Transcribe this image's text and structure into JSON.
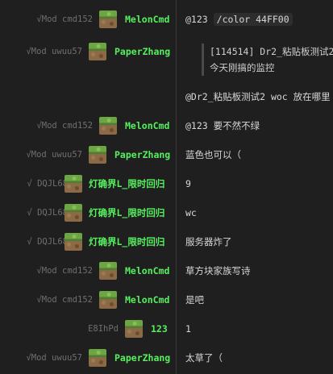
{
  "messages": [
    {
      "prefix": "√Mod cmd152",
      "name": "MelonCmd",
      "text": "@123 ",
      "code": "/color 44FF00"
    },
    {
      "prefix": "√Mod uwuu57",
      "name": "PaperZhang",
      "quote_line1": "[114514] Dr2_粘贴板测试2：",
      "quote_line2": "今天刚搞的监控",
      "text": "@Dr2_粘贴板测试2 woc 放在哪里"
    },
    {
      "prefix": "√Mod cmd152",
      "name": "MelonCmd",
      "text": "@123 要不然不绿"
    },
    {
      "prefix": "√Mod uwuu57",
      "name": "PaperZhang",
      "text": "蓝色也可以（"
    },
    {
      "prefix": "√ DQJL68",
      "name": "灯确界L_限时回归",
      "text": "9"
    },
    {
      "prefix": "√ DQJL68",
      "name": "灯确界L_限时回归",
      "text": "wc"
    },
    {
      "prefix": "√ DQJL68",
      "name": "灯确界L_限时回归",
      "text": "服务器炸了"
    },
    {
      "prefix": "√Mod cmd152",
      "name": "MelonCmd",
      "text": "草方块家族写诗"
    },
    {
      "prefix": "√Mod cmd152",
      "name": "MelonCmd",
      "text": "是吧"
    },
    {
      "prefix": "E8IhPd",
      "name": "123",
      "text": "1"
    },
    {
      "prefix": "√Mod uwuu57",
      "name": "PaperZhang",
      "text": "太草了（"
    }
  ],
  "colors": {
    "name": "#56f05f",
    "background": "#1f1f1f",
    "meta": "#6f6f6f"
  },
  "icons": {
    "avatar": "grass-block-avatar-icon"
  }
}
